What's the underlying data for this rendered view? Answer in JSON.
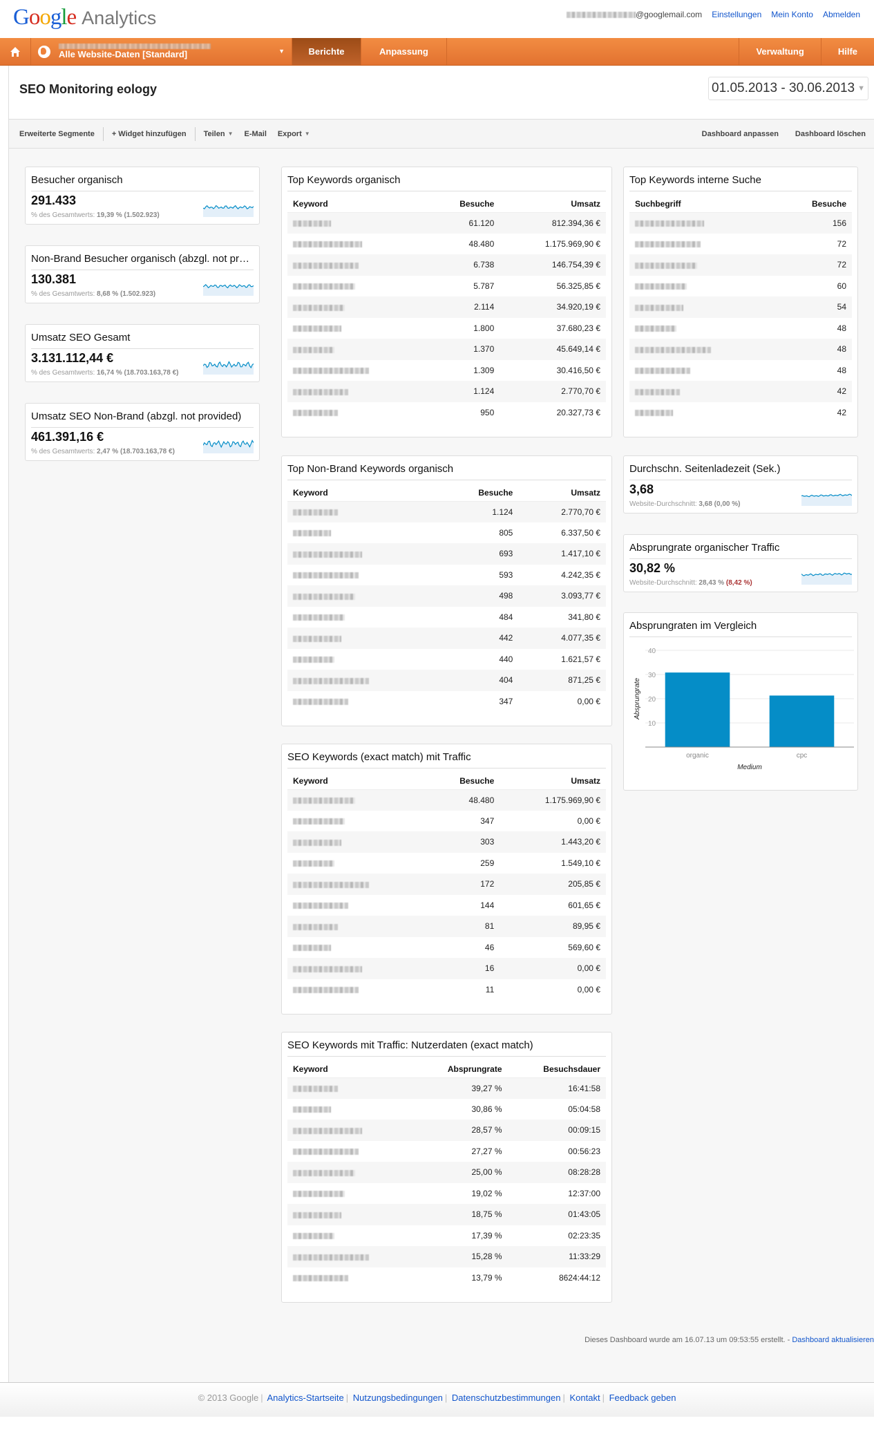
{
  "header": {
    "product": "Analytics",
    "email_suffix": "@googlemail.com",
    "links": [
      "Einstellungen",
      "Mein Konto",
      "Abmelden"
    ]
  },
  "nav": {
    "profile_label": "Alle Website-Daten [Standard]",
    "items": [
      "Berichte",
      "Anpassung"
    ],
    "active": "Berichte",
    "right_items": [
      "Verwaltung",
      "Hilfe"
    ]
  },
  "page": {
    "title": "SEO Monitoring eology",
    "date_range": "01.05.2013 - 30.06.2013"
  },
  "toolbar": {
    "segments": "Erweiterte Segmente",
    "add_widget": "+ Widget hinzufügen",
    "share": "Teilen",
    "email": "E-Mail",
    "export": "Export",
    "customize": "Dashboard anpassen",
    "delete": "Dashboard löschen"
  },
  "metrics": [
    {
      "title": "Besucher organisch",
      "value": "291.433",
      "sub_label": "% des Gesamtwerts:",
      "sub_value": "19,39 % (1.502.923)"
    },
    {
      "title": "Non-Brand Besucher organisch (abzgl. not provided)",
      "value": "130.381",
      "sub_label": "% des Gesamtwerts:",
      "sub_value": "8,68 % (1.502.923)"
    },
    {
      "title": "Umsatz SEO Gesamt",
      "value": "3.131.112,44 €",
      "sub_label": "% des Gesamtwerts:",
      "sub_value": "16,74 % (18.703.163,78 €)"
    },
    {
      "title": "Umsatz SEO Non-Brand (abzgl. not provided)",
      "value": "461.391,16 €",
      "sub_label": "% des Gesamtwerts:",
      "sub_value": "2,47 % (18.703.163,78 €)"
    },
    {
      "title": "Durchschn. Seitenladezeit (Sek.)",
      "value": "3,68",
      "sub_label": "Website-Durchschnitt:",
      "sub_value": "3,68 (0,00 %)"
    },
    {
      "title": "Absprungrate organischer Traffic",
      "value": "30,82 %",
      "sub_label": "Website-Durchschnitt:",
      "sub_value": "28,43 %",
      "sub_delta": "(8,42 %)"
    }
  ],
  "tables": {
    "top_keywords": {
      "title": "Top Keywords organisch",
      "columns": [
        "Keyword",
        "Besuche",
        "Umsatz"
      ],
      "rows": [
        [
          "[redacted]",
          "61.120",
          "812.394,36 €"
        ],
        [
          "[redacted]",
          "48.480",
          "1.175.969,90 €"
        ],
        [
          "[redacted]",
          "6.738",
          "146.754,39 €"
        ],
        [
          "[redacted]",
          "5.787",
          "56.325,85 €"
        ],
        [
          "[redacted]",
          "2.114",
          "34.920,19 €"
        ],
        [
          "[redacted]",
          "1.800",
          "37.680,23 €"
        ],
        [
          "[redacted]",
          "1.370",
          "45.649,14 €"
        ],
        [
          "[redacted]",
          "1.309",
          "30.416,50 €"
        ],
        [
          "[redacted]",
          "1.124",
          "2.770,70 €"
        ],
        [
          "[redacted]",
          "950",
          "20.327,73 €"
        ]
      ]
    },
    "internal_search": {
      "title": "Top Keywords interne Suche",
      "columns": [
        "Suchbegriff",
        "Besuche"
      ],
      "rows": [
        [
          "[redacted]",
          "156"
        ],
        [
          "[redacted]",
          "72"
        ],
        [
          "[redacted]",
          "72"
        ],
        [
          "[redacted]",
          "60"
        ],
        [
          "[redacted]",
          "54"
        ],
        [
          "[redacted]",
          "48"
        ],
        [
          "[redacted]",
          "48"
        ],
        [
          "[redacted]",
          "48"
        ],
        [
          "[redacted]",
          "42"
        ],
        [
          "[redacted]",
          "42"
        ]
      ]
    },
    "non_brand": {
      "title": "Top Non-Brand Keywords organisch",
      "columns": [
        "Keyword",
        "Besuche",
        "Umsatz"
      ],
      "rows": [
        [
          "[redacted]",
          "1.124",
          "2.770,70 €"
        ],
        [
          "[redacted]",
          "805",
          "6.337,50 €"
        ],
        [
          "[redacted]",
          "693",
          "1.417,10 €"
        ],
        [
          "[redacted]",
          "593",
          "4.242,35 €"
        ],
        [
          "[redacted]",
          "498",
          "3.093,77 €"
        ],
        [
          "[redacted]",
          "484",
          "341,80 €"
        ],
        [
          "[redacted]",
          "442",
          "4.077,35 €"
        ],
        [
          "[redacted]",
          "440",
          "1.621,57 €"
        ],
        [
          "[redacted]",
          "404",
          "871,25 €"
        ],
        [
          "[redacted]",
          "347",
          "0,00 €"
        ]
      ]
    },
    "exact_match": {
      "title": "SEO Keywords (exact match) mit Traffic",
      "columns": [
        "Keyword",
        "Besuche",
        "Umsatz"
      ],
      "rows": [
        [
          "[redacted]",
          "48.480",
          "1.175.969,90 €"
        ],
        [
          "[redacted]",
          "347",
          "0,00 €"
        ],
        [
          "[redacted]",
          "303",
          "1.443,20 €"
        ],
        [
          "[redacted]",
          "259",
          "1.549,10 €"
        ],
        [
          "[redacted]",
          "172",
          "205,85 €"
        ],
        [
          "[redacted]",
          "144",
          "601,65 €"
        ],
        [
          "[redacted]",
          "81",
          "89,95 €"
        ],
        [
          "[redacted]",
          "46",
          "569,60 €"
        ],
        [
          "[redacted]",
          "16",
          "0,00 €"
        ],
        [
          "[redacted]",
          "11",
          "0,00 €"
        ]
      ]
    },
    "user_data": {
      "title": "SEO Keywords mit Traffic: Nutzerdaten (exact match)",
      "columns": [
        "Keyword",
        "Absprungrate",
        "Besuchsdauer"
      ],
      "rows": [
        [
          "[redacted]",
          "39,27 %",
          "16:41:58"
        ],
        [
          "[redacted]",
          "30,86 %",
          "05:04:58"
        ],
        [
          "[redacted]",
          "28,57 %",
          "00:09:15"
        ],
        [
          "[redacted]",
          "27,27 %",
          "00:56:23"
        ],
        [
          "[redacted]",
          "25,00 %",
          "08:28:28"
        ],
        [
          "[redacted]",
          "19,02 %",
          "12:37:00"
        ],
        [
          "[redacted]",
          "18,75 %",
          "01:43:05"
        ],
        [
          "[redacted]",
          "17,39 %",
          "02:23:35"
        ],
        [
          "[redacted]",
          "15,28 %",
          "11:33:29"
        ],
        [
          "[redacted]",
          "13,79 %",
          "8624:44:12"
        ]
      ]
    }
  },
  "chart_data": {
    "type": "bar",
    "title": "Absprungraten im Vergleich",
    "categories": [
      "organic",
      "cpc"
    ],
    "values": [
      30.82,
      21.3
    ],
    "xlabel": "Medium",
    "ylabel": "Absprungrate",
    "ylim": [
      0,
      40
    ],
    "yticks": [
      10,
      20,
      30,
      40
    ],
    "grid": true,
    "color": "#058dc7"
  },
  "status": {
    "created": "Dieses Dashboard wurde am 16.07.13 um 09:53:55 erstellt. -",
    "refresh": "Dashboard aktualisieren"
  },
  "footer": {
    "copyright": "© 2013 Google",
    "links": [
      "Analytics-Startseite",
      "Nutzungsbedingungen",
      "Datenschutzbestimmungen",
      "Kontakt",
      "Feedback geben"
    ]
  },
  "colors": {
    "accent": "#e87b35",
    "link": "#1155cc",
    "sparkline": "#058dc7",
    "negative": "#aa3333"
  }
}
